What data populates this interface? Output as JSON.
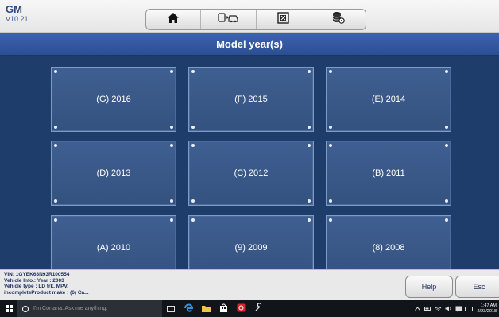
{
  "app": {
    "name": "GM",
    "version": "V10.21"
  },
  "toolbar": {
    "icons": [
      "home-icon",
      "vehicle-swap-icon",
      "screenshot-icon",
      "data-manager-icon"
    ]
  },
  "page": {
    "title": "Model year(s)"
  },
  "years": {
    "items": [
      "(G) 2016",
      "(F) 2015",
      "(E) 2014",
      "(D) 2013",
      "(C) 2012",
      "(B) 2011",
      "(A) 2010",
      "(9) 2009",
      "(8) 2008"
    ]
  },
  "info": {
    "vin": "VIN: 1GYEK63N93R100554",
    "vehicle_info": "Vehicle Info.: Year : 2003",
    "vehicle_type": "Vehicle type : LD trk, MPV,",
    "make": "incompleteProduct make : (6) Ca..."
  },
  "buttons": {
    "help": "Help",
    "esc": "Esc"
  },
  "taskbar": {
    "search_placeholder": "I'm Cortana. Ask me anything.",
    "time": "1:47 AM",
    "date": "2/23/2018"
  },
  "colors": {
    "accent": "#2c4f93",
    "background": "#1f3d6b"
  }
}
